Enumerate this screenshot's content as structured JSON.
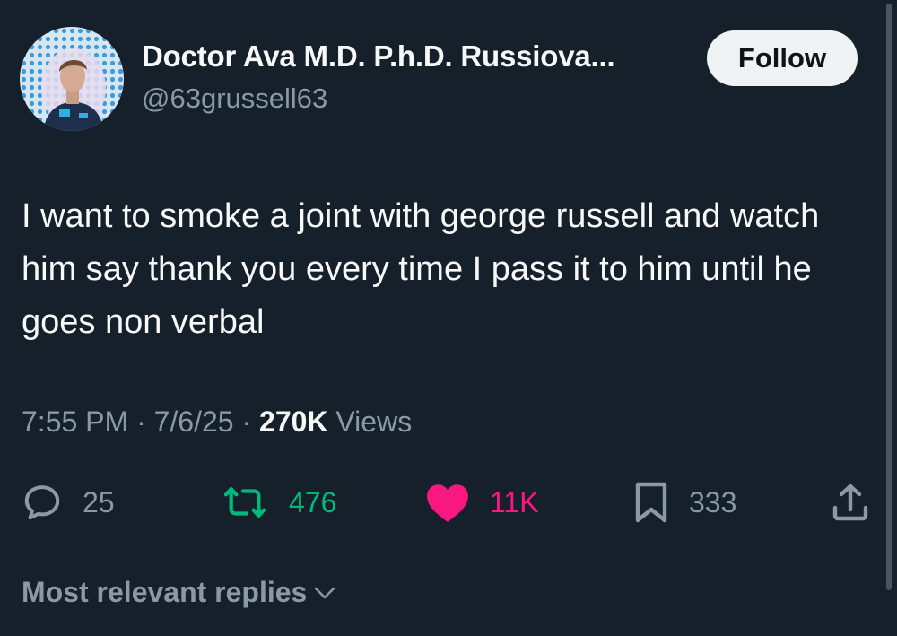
{
  "author": {
    "display_name": "Doctor Ava M.D. P.h.D. Russiova...",
    "handle": "@63grussell63",
    "avatar_icon": "profile-photo"
  },
  "follow_button": {
    "label": "Follow"
  },
  "tweet": {
    "text": "I want to smoke a joint with george russell and watch him say thank you every time I pass it to him until he goes non verbal",
    "time": "7:55 PM",
    "date": "7/6/25",
    "separator": "·",
    "views_count": "270K",
    "views_label": "Views"
  },
  "actions": {
    "replies": "25",
    "reposts": "476",
    "likes": "11K",
    "bookmarks": "333"
  },
  "replies_sort": {
    "label": "Most relevant replies"
  },
  "colors": {
    "background": "#15202b",
    "repost_active": "#00ba7c",
    "like_active": "#f91880",
    "muted": "#8b98a5"
  }
}
